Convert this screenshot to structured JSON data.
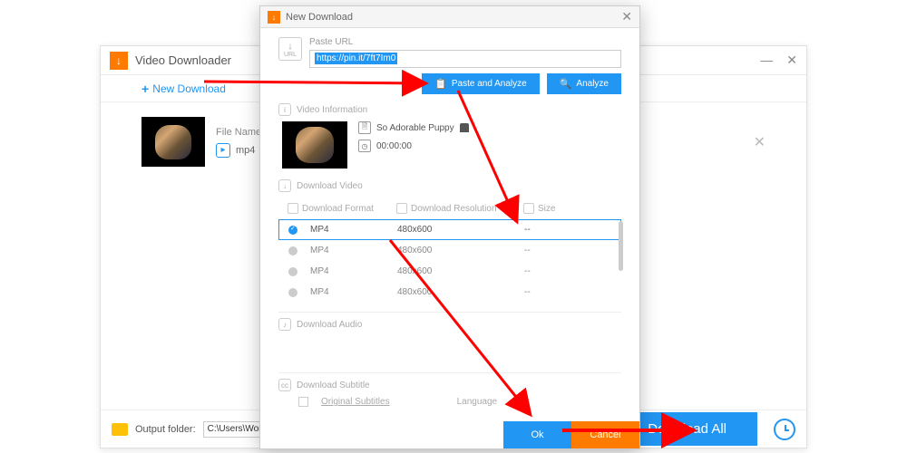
{
  "main": {
    "title": "Video Downloader",
    "newDownload": "New Download",
    "fileName": "File Name:",
    "format": "mp4",
    "outputLabel": "Output folder:",
    "outputPath": "C:\\Users\\WonderFox\\Desktop\\",
    "downloadAll": "Download All"
  },
  "dialog": {
    "title": "New Download",
    "pasteUrl": "Paste URL",
    "urlValue": "https://pin.it/7ft7Im0",
    "pasteAnalyze": "Paste and Analyze",
    "analyze": "Analyze",
    "videoInfo": "Video Information",
    "videoTitle": "So Adorable Puppy",
    "duration": "00:00:00",
    "downloadVideo": "Download Video",
    "colFormat": "Download Format",
    "colRes": "Download Resolution",
    "colSize": "Size",
    "formats": [
      {
        "fmt": "MP4",
        "res": "480x600",
        "size": "--",
        "selected": true
      },
      {
        "fmt": "MP4",
        "res": "480x600",
        "size": "--",
        "selected": false
      },
      {
        "fmt": "MP4",
        "res": "480x600",
        "size": "--",
        "selected": false
      },
      {
        "fmt": "MP4",
        "res": "480x600",
        "size": "--",
        "selected": false
      }
    ],
    "downloadAudio": "Download Audio",
    "downloadSubtitle": "Download Subtitle",
    "originalSubtitles": "Original Subtitles",
    "language": "Language",
    "ok": "Ok",
    "cancel": "Cancel"
  }
}
